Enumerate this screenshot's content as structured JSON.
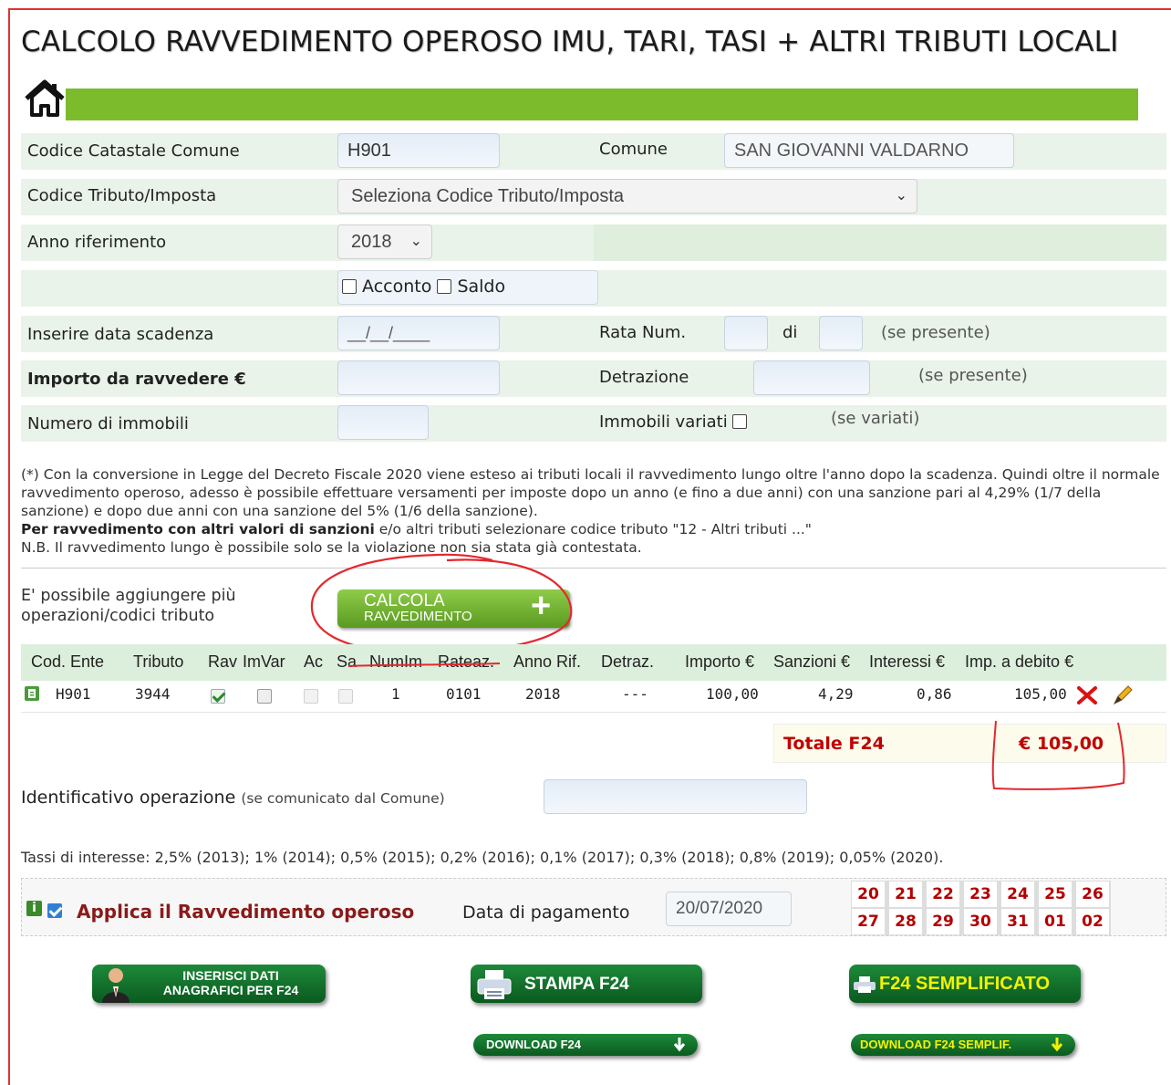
{
  "title": "CALCOLO RAVVEDIMENTO OPEROSO IMU, TARI, TASI + ALTRI TRIBUTI LOCALI",
  "form": {
    "codice_catastale_label": "Codice Catastale Comune",
    "codice_catastale_value": "H901",
    "comune_label": "Comune",
    "comune_value": "SAN GIOVANNI VALDARNO",
    "codice_tributo_label": "Codice Tributo/Imposta",
    "codice_tributo_selected": "Seleziona Codice Tributo/Imposta",
    "anno_label": "Anno riferimento",
    "anno_selected": "2018",
    "acconto_label": "Acconto",
    "saldo_label": "Saldo",
    "data_scadenza_label": "Inserire data scadenza",
    "data_scadenza_placeholder": "__/__/____",
    "rata_label": "Rata Num.",
    "di_label": "di",
    "se_presente_1": "(se presente)",
    "importo_label": "Importo da ravvedere €",
    "detrazione_label": "Detrazione",
    "se_presente_2": "(se presente)",
    "numero_immobili_label": "Numero di immobili",
    "immobili_variati_label": "Immobili variati",
    "se_variati": "(se variati)"
  },
  "note": {
    "line1": "(*) Con la conversione in Legge del Decreto Fiscale 2020 viene esteso ai tributi locali il ravvedimento lungo oltre l'anno dopo la scadenza. Quindi oltre il normale ravvedimento operoso, adesso è possibile effettuare versamenti per imposte dopo un anno (e fino a due anni) con una sanzione pari al 4,29% (1/7 della sanzione) e dopo due anni con una sanzione del 5% (1/6 della sanzione).",
    "bold": "Per ravvedimento con altri valori di sanzioni",
    "line2": " e/o altri tributi selezionare codice tributo \"12 - Altri tributi ...\"",
    "line3": "N.B. Il ravvedimento lungo è possibile solo se la violazione non sia stata già contestata."
  },
  "add_ops_label": "E' possibile aggiungere più operazioni/codici tributo",
  "calcola_button": {
    "line1": "CALCOLA",
    "line2": "RAVVEDIMENTO",
    "plus": "+"
  },
  "table": {
    "headers": [
      "Cod. Ente",
      "Tributo",
      "Rav",
      "ImVar",
      "Ac",
      "Sa",
      "NumIm",
      "Rateaz.",
      "Anno Rif.",
      "Detraz.",
      "Importo €",
      "Sanzioni €",
      "Interessi €",
      "Imp. a debito €"
    ],
    "row": {
      "cod_ente": "H901",
      "tributo": "3944",
      "num_im": "1",
      "rateaz": "0101",
      "anno_rif": "2018",
      "detraz": "---",
      "importo": "100,00",
      "sanzioni": "4,29",
      "interessi": "0,86",
      "imp_debito": "105,00"
    }
  },
  "totale": {
    "label": "Totale F24",
    "value": "€ 105,00"
  },
  "identificativo": {
    "label": "Identificativo operazione",
    "hint": "(se comunicato dal Comune)"
  },
  "tassi": "Tassi di interesse: 2,5% (2013); 1% (2014); 0,5% (2015); 0,2% (2016); 0,1% (2017); 0,3% (2018); 0,8% (2019); 0,05% (2020).",
  "applica": {
    "label": "Applica il Ravvedimento operoso",
    "data_pagamento_label": "Data di pagamento",
    "data_pagamento_value": "20/07/2020",
    "days_row1": [
      "20",
      "21",
      "22",
      "23",
      "24",
      "25",
      "26"
    ],
    "days_row2": [
      "27",
      "28",
      "29",
      "30",
      "31",
      "01",
      "02"
    ]
  },
  "buttons": {
    "anagrafici_line1": "INSERISCI DATI",
    "anagrafici_line2": "ANAGRAFICI PER F24",
    "stampa": "STAMPA F24",
    "semplificato": "F24 SEMPLIFICATO",
    "download": "DOWNLOAD F24",
    "download_semplif": "DOWNLOAD F24 SEMPLIF."
  },
  "colors": {
    "accent_green": "#7cbb2c",
    "row_bg": "#e9f3e9",
    "dark_green_button": "#0b5a1f",
    "total_red": "#c00000"
  }
}
